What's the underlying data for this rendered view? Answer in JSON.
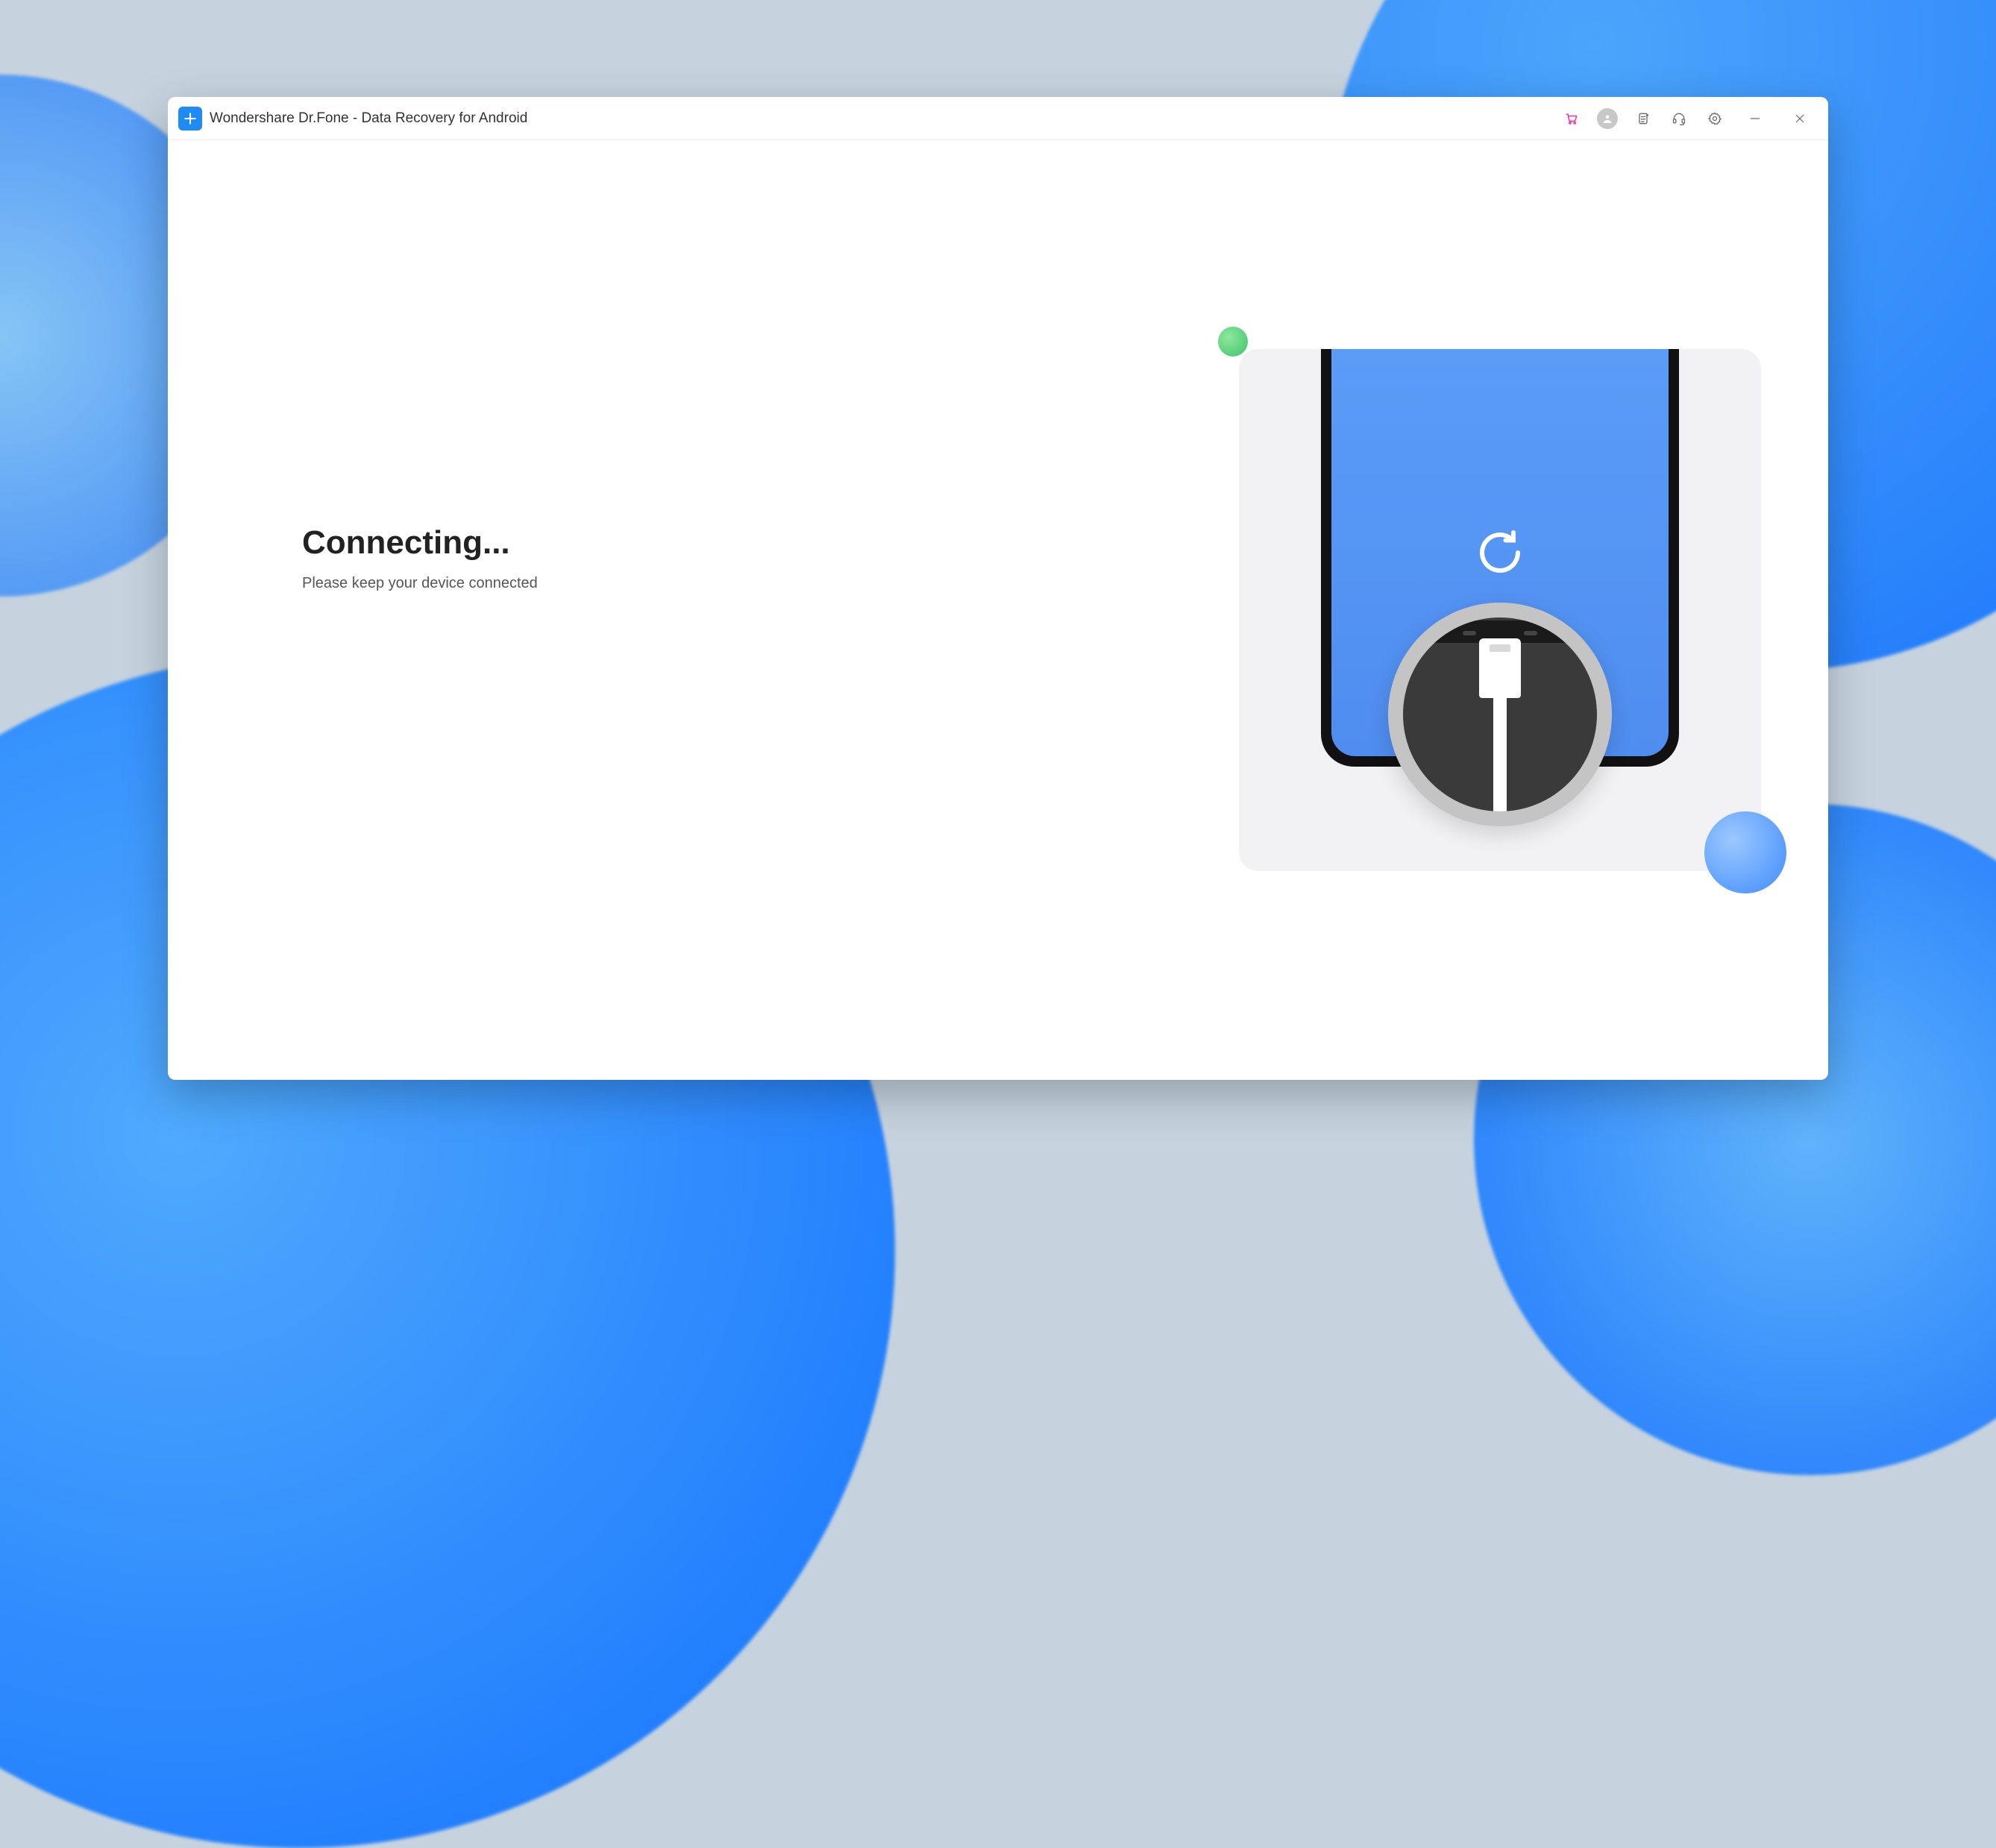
{
  "titlebar": {
    "app_title": "Wondershare Dr.Fone - Data Recovery for Android"
  },
  "content": {
    "heading": "Connecting...",
    "subtext": "Please keep your device connected"
  },
  "colors": {
    "accent": "#1f8cf5",
    "cart": "#ff2fa8"
  }
}
